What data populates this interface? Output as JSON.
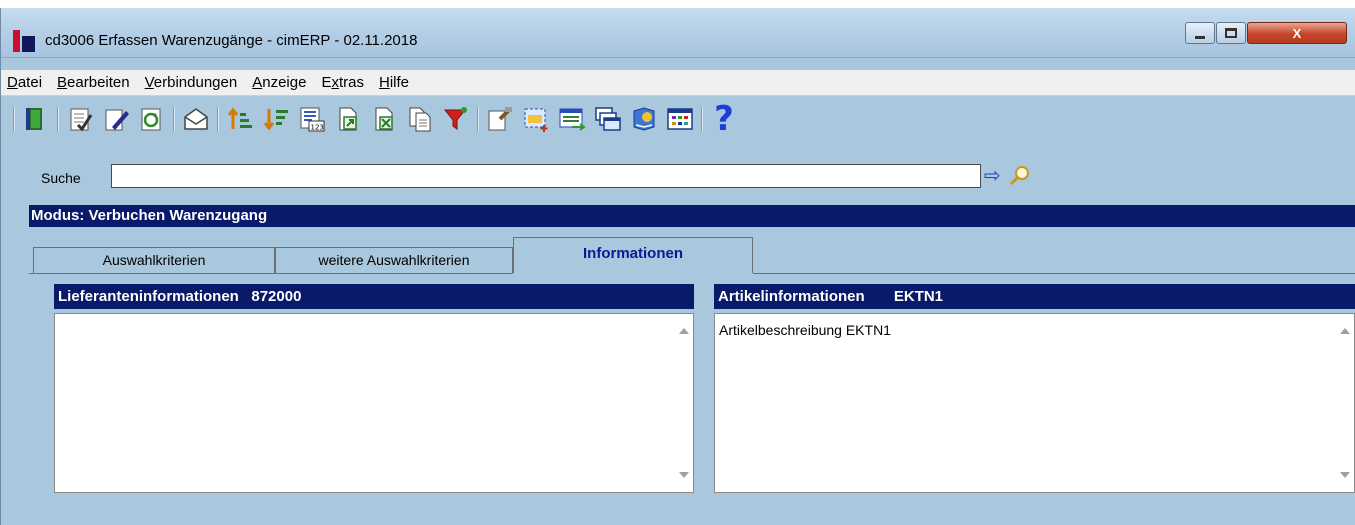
{
  "window": {
    "title": "cd3006 Erfassen Warenzugänge - cimERP - 02.11.2018",
    "close_label": "X"
  },
  "menu": {
    "items": [
      {
        "first": "D",
        "rest": "atei"
      },
      {
        "first": "B",
        "rest": "earbeiten"
      },
      {
        "first": "V",
        "rest": "erbindungen"
      },
      {
        "first": "A",
        "rest": "nzeige"
      },
      {
        "pre": "E",
        "ul": "x",
        "post": "tras"
      },
      {
        "first": "H",
        "rest": "ilfe"
      }
    ]
  },
  "toolbar": {
    "icons": [
      "exit-door-icon",
      "checklist-icon",
      "edit-pencil-icon",
      "refresh-icon",
      "mail-icon",
      "sort-ascending-icon",
      "sort-descending-icon",
      "number-format-icon",
      "export-document-icon",
      "export-excel-icon",
      "copy-document-icon",
      "filter-funnel-icon",
      "settings-tools-icon",
      "new-record-icon",
      "transfer-records-icon",
      "windows-icon",
      "bookmark-icon",
      "calendar-grid-icon",
      "help-icon"
    ],
    "help_glyph": "?"
  },
  "search": {
    "label": "Suche",
    "value": ""
  },
  "mode": {
    "text": "Modus: Verbuchen Warenzugang"
  },
  "tabs": [
    {
      "label": "Auswahlkriterien",
      "active": false
    },
    {
      "label": "weitere Auswahlkriterien",
      "active": false
    },
    {
      "label": "Informationen",
      "active": true
    }
  ],
  "panels": {
    "supplier": {
      "title": "Lieferanteninformationen   872000",
      "content": ""
    },
    "article": {
      "title": "Artikelinformationen       EKTN1",
      "content": "Artikelbeschreibung EKTN1"
    }
  },
  "colors": {
    "window_bg": "#a9c7dd",
    "header_navy": "#0a1a6b",
    "active_tab_text": "#0a1a8f",
    "help_blue": "#1a3fd6"
  }
}
